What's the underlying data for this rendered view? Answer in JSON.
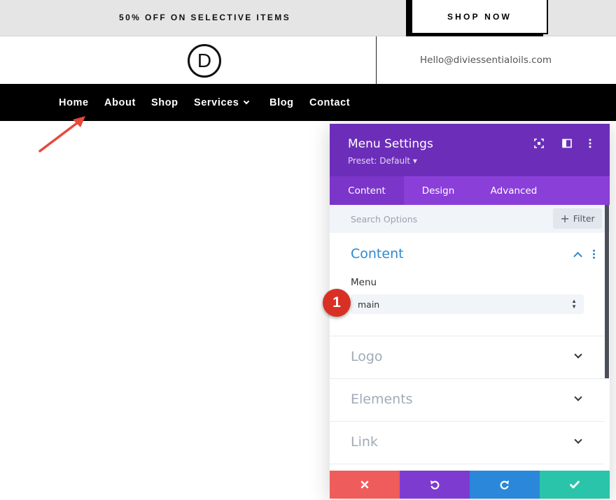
{
  "promo": {
    "text": "50% OFF ON SELECTIVE ITEMS",
    "button_label": "SHOP NOW"
  },
  "header": {
    "logo_letter": "D",
    "email": "Hello@diviessentialoils.com"
  },
  "nav": {
    "items": [
      {
        "label": "Home"
      },
      {
        "label": "About"
      },
      {
        "label": "Shop"
      },
      {
        "label": "Services",
        "has_dropdown": true
      },
      {
        "label": "Blog"
      },
      {
        "label": "Contact"
      }
    ]
  },
  "panel": {
    "title": "Menu Settings",
    "preset": "Preset: Default ▾",
    "tabs": [
      {
        "label": "Content",
        "active": true
      },
      {
        "label": "Design",
        "active": false
      },
      {
        "label": "Advanced",
        "active": false
      }
    ],
    "search_placeholder": "Search Options",
    "filter_label": "Filter",
    "content_section": {
      "title": "Content",
      "menu_label": "Menu",
      "menu_value": "main"
    },
    "collapsed_sections": [
      {
        "title": "Logo"
      },
      {
        "title": "Elements"
      },
      {
        "title": "Link"
      }
    ]
  },
  "annotation": {
    "badge_number": "1"
  },
  "colors": {
    "panel_header": "#6c2eb9",
    "tabs_bar": "#8a3fd8",
    "section_accent": "#2e88cf",
    "cancel": "#ef5c5c",
    "undo": "#7e3bd0",
    "redo": "#2b87da",
    "save": "#29c4a9",
    "arrow": "#e8483c",
    "badge": "#d93025"
  },
  "icons": {
    "panel_header": [
      "fullscreen-icon",
      "split-view-icon",
      "more-vertical-icon"
    ],
    "footer": [
      "close-icon",
      "undo-icon",
      "redo-icon",
      "checkmark-icon"
    ]
  }
}
